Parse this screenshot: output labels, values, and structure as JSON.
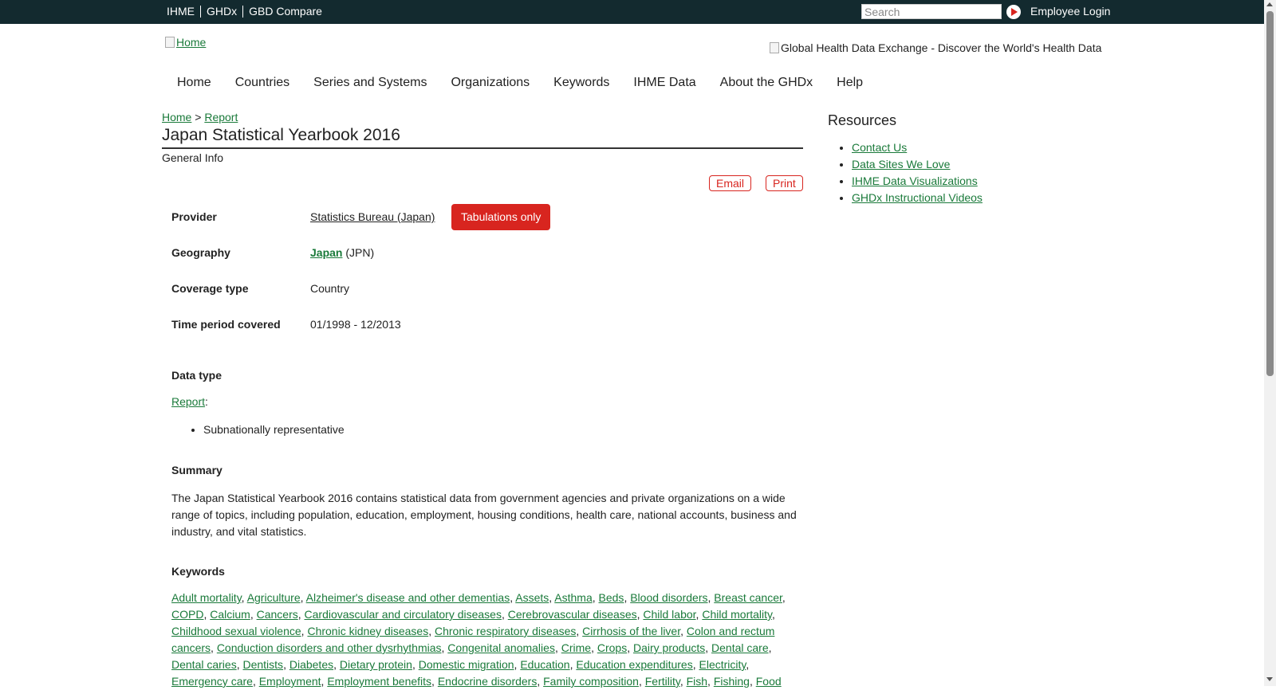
{
  "topbar": {
    "links": [
      "IHME",
      "GHDx",
      "GBD Compare"
    ],
    "search_placeholder": "Search",
    "login": "Employee Login"
  },
  "header": {
    "home_alt": "Home",
    "banner_alt": "Global Health Data Exchange - Discover the World's Health Data"
  },
  "nav": [
    "Home",
    "Countries",
    "Series and Systems",
    "Organizations",
    "Keywords",
    "IHME Data",
    "About the GHDx",
    "Help"
  ],
  "breadcrumb": {
    "home": "Home",
    "sep": ">",
    "current": "Report"
  },
  "page": {
    "title": "Japan Statistical Yearbook 2016",
    "general_info": "General Info",
    "email_label": "Email",
    "print_label": "Print"
  },
  "fields": {
    "provider_label": "Provider",
    "provider_value": "Statistics Bureau (Japan)",
    "tabulations": "Tabulations only",
    "geography_label": "Geography",
    "geography_link": "Japan",
    "geography_code": " (JPN)",
    "coverage_label": "Coverage type",
    "coverage_value": "Country",
    "time_label": "Time period covered",
    "time_value": "01/1998 - 12/2013",
    "datatype_label": "Data type",
    "datatype_link": "Report",
    "datatype_colon": ":",
    "datatype_items": [
      "Subnationally representative"
    ],
    "summary_label": "Summary",
    "summary_text": "The Japan Statistical Yearbook 2016 contains statistical data from government agencies and private organizations on a wide range of topics, including population, education, employment, housing conditions, health care, national accounts, business and industry, and vital statistics.",
    "keywords_label": "Keywords"
  },
  "keywords": [
    "Adult mortality",
    "Agriculture",
    "Alzheimer's disease and other dementias",
    "Assets",
    "Asthma",
    "Beds",
    "Blood disorders",
    "Breast cancer",
    "COPD",
    "Calcium",
    "Cancers",
    "Cardiovascular and circulatory diseases",
    "Cerebrovascular diseases",
    "Child labor",
    "Child mortality",
    "Childhood sexual violence",
    "Chronic kidney diseases",
    "Chronic respiratory diseases",
    "Cirrhosis of the liver",
    "Colon and rectum cancers",
    "Conduction disorders and other dysrhythmias",
    "Congenital anomalies",
    "Crime",
    "Crops",
    "Dairy products",
    "Dental care",
    "Dental caries",
    "Dentists",
    "Diabetes",
    "Dietary protein",
    "Domestic migration",
    "Education",
    "Education expenditures",
    "Electricity",
    "Emergency care",
    "Employment",
    "Employment benefits",
    "Endocrine disorders",
    "Family composition",
    "Fertility",
    "Fish",
    "Fishing",
    "Food"
  ],
  "resources": {
    "title": "Resources",
    "links": [
      "Contact Us",
      "Data Sites We Love",
      "IHME Data Visualizations",
      "GHDx Instructional Videos"
    ]
  },
  "colors": {
    "topbar": "#132a2f",
    "accent_red": "#d8251f",
    "link_green": "#1a7a3a"
  }
}
